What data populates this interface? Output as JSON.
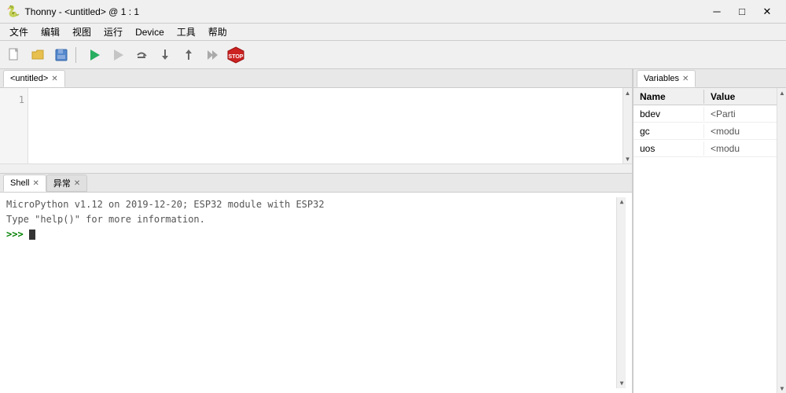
{
  "titlebar": {
    "icon": "🐍",
    "text": "Thonny  -  <untitled>  @  1 : 1",
    "minimize": "─",
    "maximize": "□",
    "close": "✕"
  },
  "menubar": {
    "items": [
      "文件",
      "编辑",
      "视图",
      "运行",
      "Device",
      "工具",
      "帮助"
    ]
  },
  "toolbar": {
    "buttons": [
      {
        "name": "new",
        "icon": "📄"
      },
      {
        "name": "open",
        "icon": "📂"
      },
      {
        "name": "save",
        "icon": "💾"
      },
      {
        "name": "run",
        "icon": "▶"
      },
      {
        "name": "debug",
        "icon": "🐞"
      },
      {
        "name": "step-over",
        "icon": "↷"
      },
      {
        "name": "step-into",
        "icon": "↡"
      },
      {
        "name": "step-out",
        "icon": "↑"
      },
      {
        "name": "resume",
        "icon": "▶▶"
      },
      {
        "name": "stop",
        "icon": "STOP"
      }
    ]
  },
  "editor": {
    "tab_label": "<untitled>",
    "line_numbers": [
      "1"
    ],
    "content": ""
  },
  "shell": {
    "tabs": [
      {
        "label": "Shell",
        "active": true
      },
      {
        "label": "异常",
        "active": false
      }
    ],
    "output_line1": "MicroPython v1.12 on 2019-12-20; ESP32 module with ESP32",
    "output_line2": "Type \"help()\" for more information.",
    "prompt": ">>>"
  },
  "variables": {
    "tab_label": "Variables",
    "col_name": "Name",
    "col_value": "Value",
    "rows": [
      {
        "name": "bdev",
        "value": "<Parti"
      },
      {
        "name": "gc",
        "value": "<modu"
      },
      {
        "name": "uos",
        "value": "<modu"
      }
    ]
  }
}
